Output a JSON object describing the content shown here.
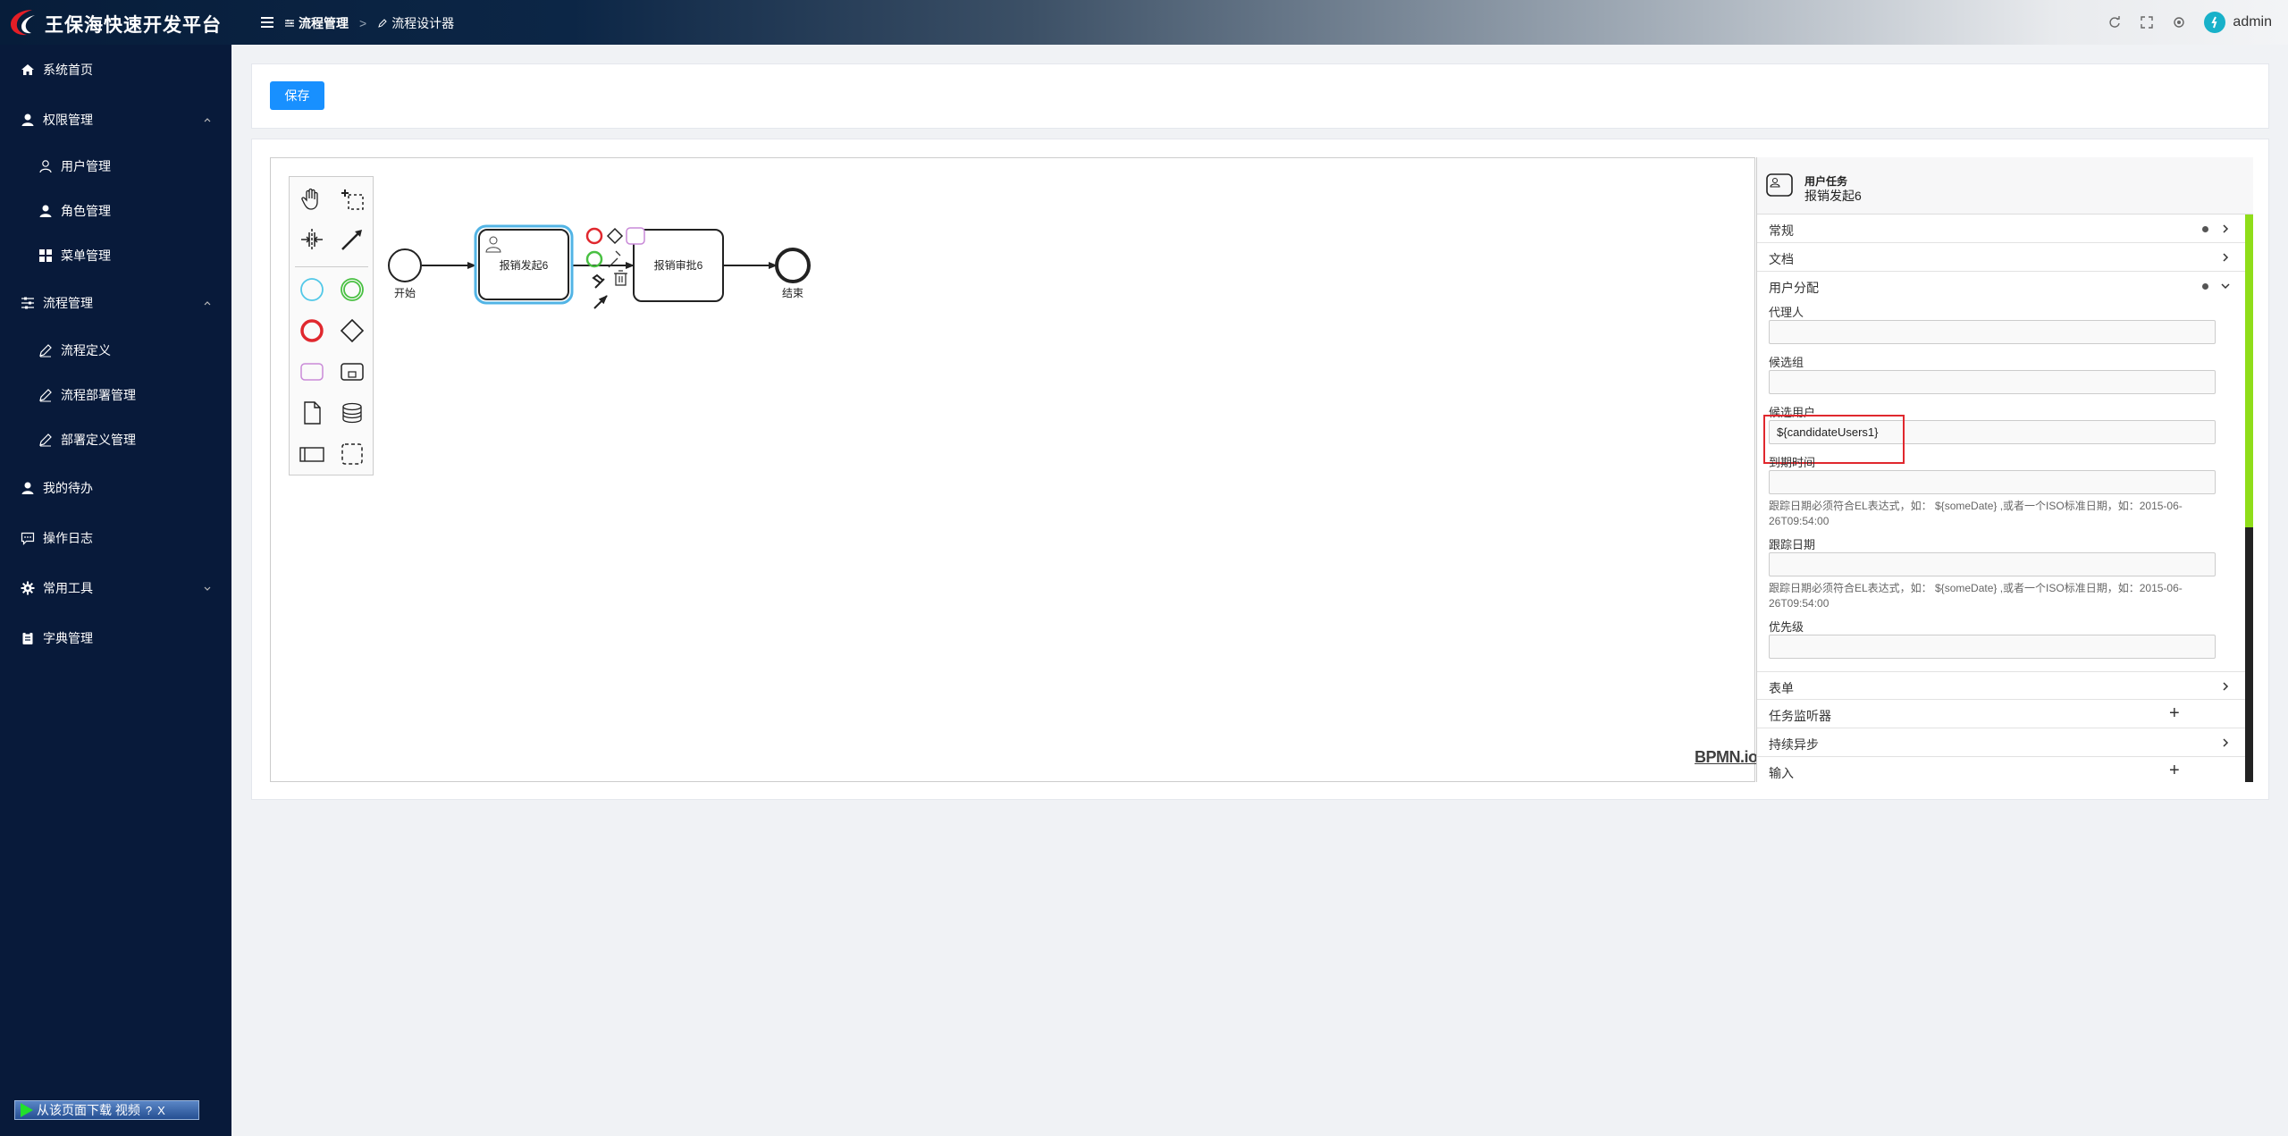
{
  "app": {
    "title": "王保海快速开发平台"
  },
  "breadcrumb": [
    {
      "label": "流程管理"
    },
    {
      "label": "流程设计器"
    }
  ],
  "user": {
    "name": "admin"
  },
  "sidebar": {
    "items": [
      {
        "label": "系统首页"
      },
      {
        "label": "权限管理"
      },
      {
        "label": "用户管理"
      },
      {
        "label": "角色管理"
      },
      {
        "label": "菜单管理"
      },
      {
        "label": "流程管理"
      },
      {
        "label": "流程定义"
      },
      {
        "label": "流程部署管理"
      },
      {
        "label": "部署定义管理"
      },
      {
        "label": "我的待办"
      },
      {
        "label": "操作日志"
      },
      {
        "label": "常用工具"
      },
      {
        "label": "字典管理"
      }
    ]
  },
  "toolbar": {
    "save_label": "保存"
  },
  "diagram": {
    "start_label": "开始",
    "task1_label": "报销发起6",
    "task2_label": "报销审批6",
    "end_label": "结束",
    "watermark": "BPMN.io"
  },
  "properties": {
    "header_type": "用户任务",
    "header_name": "报销发起6",
    "groups": {
      "general": "常规",
      "documentation": "文档",
      "assignment": "用户分配",
      "form": "表单",
      "task_listener": "任务监听器",
      "async": "持续异步",
      "input": "输入"
    },
    "fields": {
      "assignee_label": "代理人",
      "assignee_value": "",
      "candidate_groups_label": "候选组",
      "candidate_groups_value": "",
      "candidate_users_label": "候选用户",
      "candidate_users_value": "${candidateUsers1}",
      "due_date_label": "到期时间",
      "due_date_value": "",
      "due_date_desc": "跟踪日期必须符合EL表达式，如： ${someDate} ,或者一个ISO标准日期，如：2015-06-26T09:54:00",
      "follow_up_label": "跟踪日期",
      "follow_up_value": "",
      "follow_up_desc": "跟踪日期必须符合EL表达式，如： ${someDate} ,或者一个ISO标准日期，如：2015-06-26T09:54:00",
      "priority_label": "优先级",
      "priority_value": ""
    }
  },
  "download_bar": {
    "label": "从该页面下载 视频",
    "help": "?",
    "close": "X"
  },
  "colors": {
    "sidebar_bg": "#081a3a",
    "save_button": "#1890ff",
    "selection": "#52b4e5",
    "highlight": "#e0282e",
    "scroll_thumb": "#8fdd19"
  }
}
